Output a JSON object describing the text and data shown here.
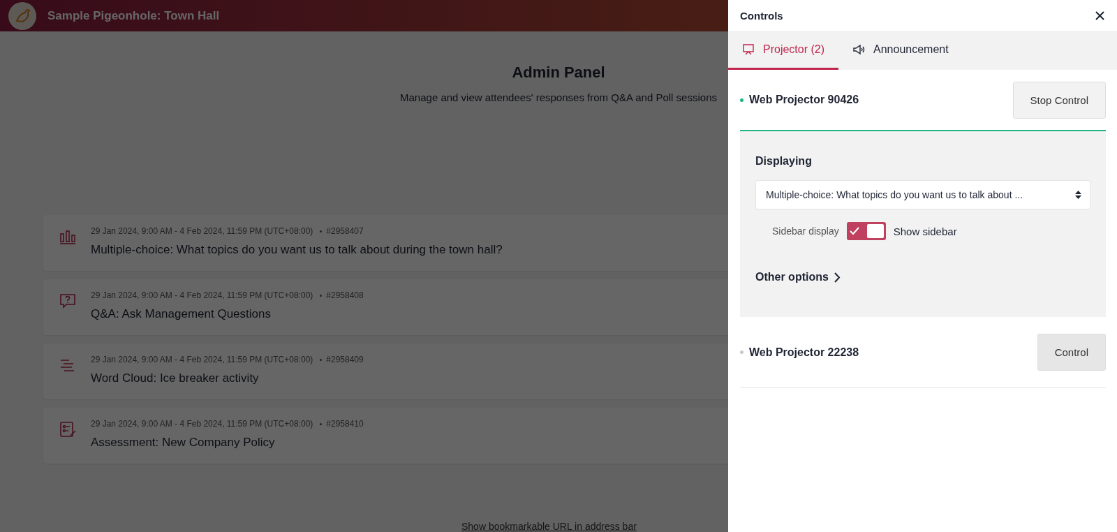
{
  "header": {
    "title": "Sample Pigeonhole: Town Hall"
  },
  "page": {
    "title": "Admin Panel",
    "subtitle": "Manage and view attendees' responses from Q&A and Poll sessions"
  },
  "sessions": [
    {
      "kind": "poll",
      "dates": "29 Jan 2024, 9:00 AM - 4 Feb 2024, 11:59 PM (UTC+08:00)",
      "id": "#2958407",
      "title": "Multiple-choice: What topics do you want us to talk about during the town hall?"
    },
    {
      "kind": "qna",
      "dates": "29 Jan 2024, 9:00 AM - 4 Feb 2024, 11:59 PM (UTC+08:00)",
      "id": "#2958408",
      "title": "Q&A: Ask Management Questions"
    },
    {
      "kind": "wordcloud",
      "dates": "29 Jan 2024, 9:00 AM - 4 Feb 2024, 11:59 PM (UTC+08:00)",
      "id": "#2958409",
      "title": "Word Cloud: Ice breaker activity"
    },
    {
      "kind": "assessment",
      "dates": "29 Jan 2024, 9:00 AM - 4 Feb 2024, 11:59 PM (UTC+08:00)",
      "id": "#2958410",
      "title": "Assessment: New Company Policy"
    }
  ],
  "footer_link": "Show bookmarkable URL in address bar",
  "controls": {
    "title": "Controls",
    "tabs": [
      {
        "kind": "projector",
        "label": "Projector (2)",
        "selected": true
      },
      {
        "kind": "announcement",
        "label": "Announcement",
        "selected": false
      }
    ],
    "projectors": [
      {
        "name": "Web Projector 90426",
        "active": true,
        "button": "Stop Control",
        "displaying": {
          "label": "Displaying",
          "value": "Multiple-choice: What topics do you want us to talk about ...",
          "sidebar_label": "Sidebar display",
          "sidebar_on": true,
          "sidebar_text": "Show sidebar",
          "other_options": "Other options"
        }
      },
      {
        "name": "Web Projector 22238",
        "active": false,
        "button": "Control"
      }
    ]
  }
}
